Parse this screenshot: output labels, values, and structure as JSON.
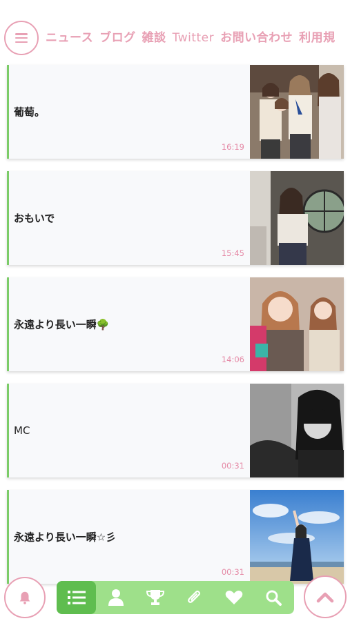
{
  "header": {
    "tabs": [
      {
        "label": "ニュース",
        "active": false
      },
      {
        "label": "ブログ",
        "active": true
      },
      {
        "label": "雑談",
        "active": false
      },
      {
        "label": "Twitter",
        "active": false
      },
      {
        "label": "お問い合わせ",
        "active": false
      },
      {
        "label": "利用規",
        "active": false
      }
    ]
  },
  "posts": [
    {
      "title": "葡萄。",
      "time": "16:19"
    },
    {
      "title": "おもいで",
      "time": "15:45"
    },
    {
      "title": "永遠より長い一瞬🌳",
      "time": "14:06"
    },
    {
      "title": "MC",
      "time": "00:31"
    },
    {
      "title": "永遠より長い一瞬☆彡",
      "time": "00:31"
    }
  ],
  "bottom_nav": {
    "items": [
      "list-icon",
      "person-icon",
      "trophy-icon",
      "paperclip-icon",
      "heart-icon",
      "search-icon"
    ],
    "active": "list-icon"
  },
  "colors": {
    "accent_pink": "#e8a0b4",
    "accent_green": "#9ee08a",
    "active_green": "#5fbd4f",
    "tab_underline": "#c895c8"
  }
}
